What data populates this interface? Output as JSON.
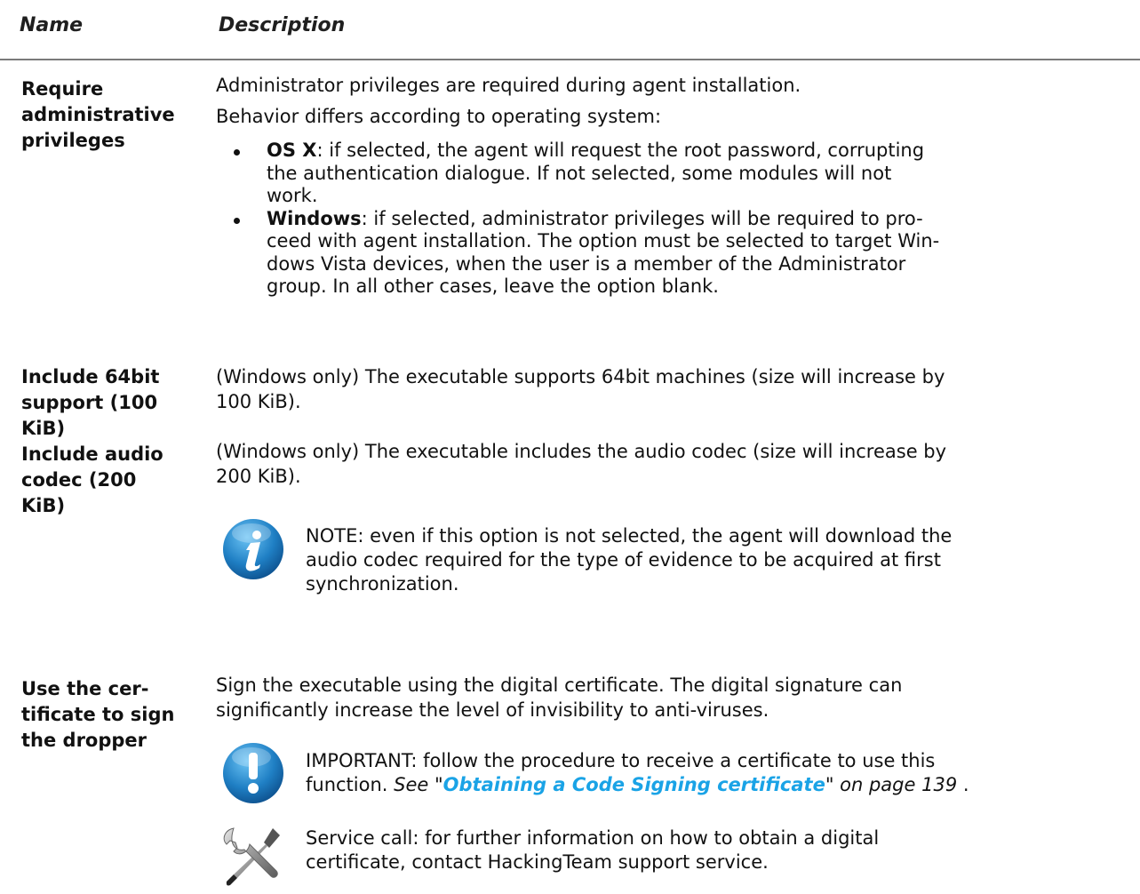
{
  "header": {
    "name": "Name",
    "description": "Description"
  },
  "rows": [
    {
      "name_lines": [
        "Require",
        "administrative",
        "privileges"
      ],
      "paragraphs": [
        "Administrator privileges are required during agent installation.",
        "Behavior differs according to operating system:"
      ],
      "bullets": [
        {
          "term": "OS X",
          "lines": [
            ": if selected, the agent will request the root password, corrupting",
            "the authentication dialogue. If not selected, some modules will not",
            "work."
          ]
        },
        {
          "term": "Windows",
          "lines": [
            ": if selected, administrator privileges will be required to pro-",
            "ceed with agent installation. The option must be selected to target Win-",
            "dows Vista devices, when the user is a member of the Administrator",
            "group. In all other cases, leave the option blank."
          ]
        }
      ]
    },
    {
      "name_lines": [
        "Include 64bit",
        "support (100",
        "KiB)"
      ],
      "paragraphs": [
        "(Windows only) The executable supports 64bit machines (size will increase by",
        "100 KiB)."
      ]
    },
    {
      "name_lines": [
        "Include audio",
        "codec (200",
        "KiB)"
      ],
      "paragraphs": [
        "(Windows only) The executable includes the audio codec (size will increase by",
        "200 KiB)."
      ],
      "note": {
        "icon": "info-icon",
        "lines": [
          "NOTE: even if this option is not selected, the agent will download the",
          "audio codec required for the type of evidence to be acquired at first",
          "synchronization."
        ]
      }
    },
    {
      "name_lines": [
        "Use the cer-",
        "tificate to sign",
        "the dropper"
      ],
      "paragraphs": [
        "Sign the executable using the digital certificate. The digital signature can",
        "significantly increase the level of invisibility to anti-viruses."
      ],
      "important": {
        "icon": "exclamation-icon",
        "line1": "IMPORTANT: follow the procedure to receive a certificate to use this",
        "line2_prefix": "function. ",
        "see": "See \"",
        "link": "Obtaining a Code Signing certificate",
        "see_suffix": "\" on page 139",
        "tail": " ."
      },
      "service": {
        "icon": "tools-icon",
        "lines": [
          "Service call: for further information on how to obtain a digital",
          "certificate, contact HackingTeam support service."
        ]
      }
    }
  ],
  "colors": {
    "link": "#1aa3e6",
    "info_icon": "#1f7fc4",
    "rule": "#7a7a7a"
  }
}
